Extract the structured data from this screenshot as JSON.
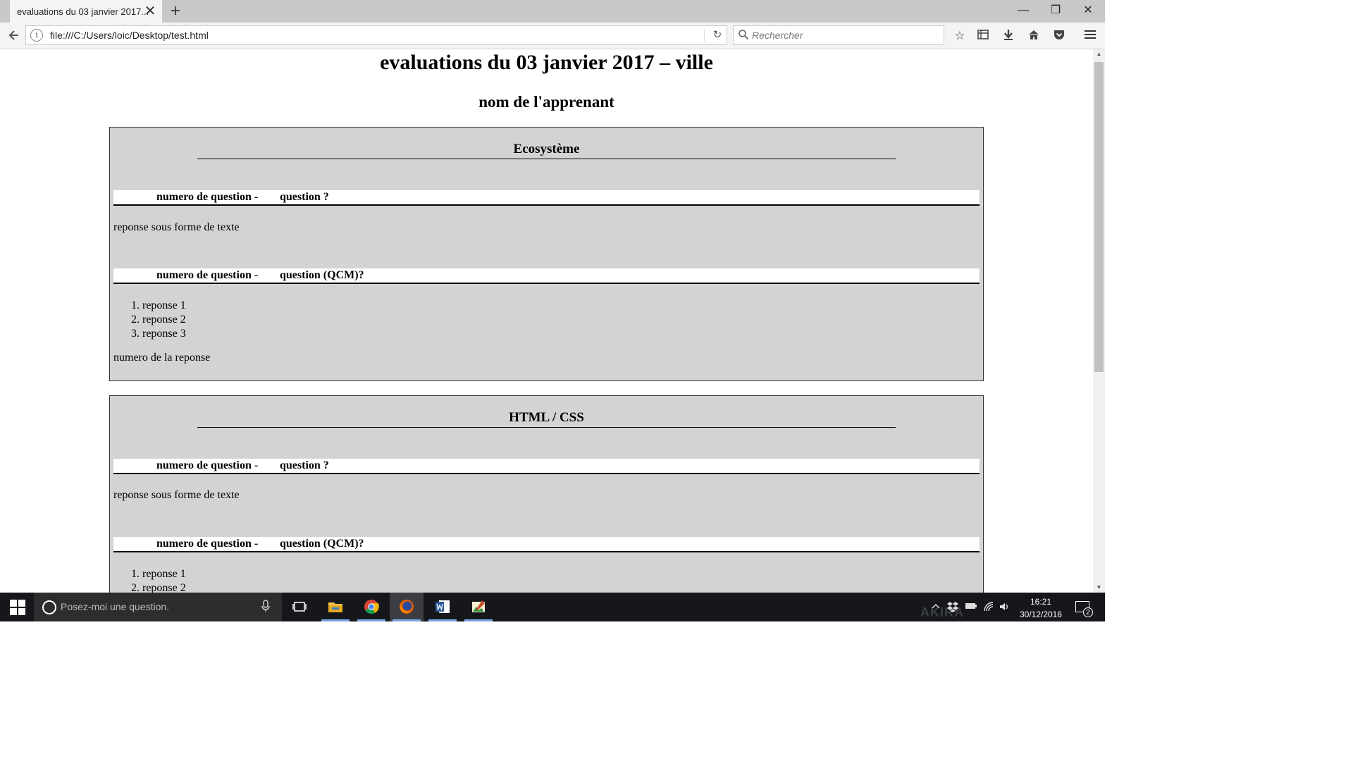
{
  "browser": {
    "tab_title": "evaluations du 03 janvier 2017...",
    "url": "file:///C:/Users/loic/Desktop/test.html",
    "search_placeholder": "Rechercher"
  },
  "page": {
    "title": "evaluations du 03 janvier 2017 – ville",
    "learner": "nom de l'apprenant",
    "sections": [
      {
        "title": "Ecosystème",
        "q1": {
          "num": "numero de question -",
          "text": "question ?",
          "answer": "reponse sous forme de texte"
        },
        "q2": {
          "num": "numero de question -",
          "text": "question (QCM)?",
          "options": [
            "reponse 1",
            "reponse 2",
            "reponse 3"
          ],
          "answer": "numero de la reponse"
        }
      },
      {
        "title": "HTML / CSS",
        "q1": {
          "num": "numero de question -",
          "text": "question ?",
          "answer": "reponse sous forme de texte"
        },
        "q2": {
          "num": "numero de question -",
          "text": "question (QCM)?",
          "options": [
            "reponse 1",
            "reponse 2"
          ]
        }
      }
    ]
  },
  "taskbar": {
    "cortana_placeholder": "Posez-moi une question.",
    "time": "16:21",
    "date": "30/12/2016",
    "notification_count": "2",
    "wallpaper_text": "AKIRA"
  },
  "colors": {
    "section_bg": "#d3d3d3",
    "tab_bar": "#c8c8c8",
    "taskbar": "#15171b"
  }
}
